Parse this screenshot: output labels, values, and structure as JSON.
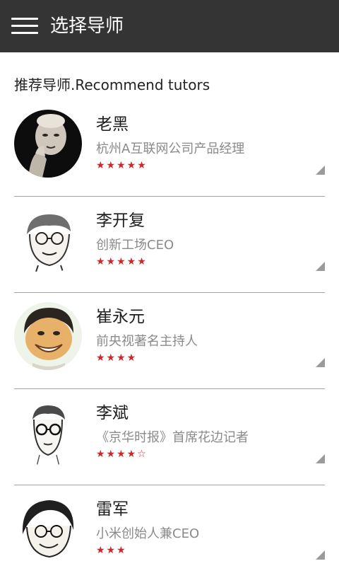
{
  "header": {
    "title": "选择导师",
    "menu_icon": "hamburger-menu-icon"
  },
  "section": {
    "heading": "推荐导师.Recommend tutors"
  },
  "tutors": [
    {
      "name": "老黑",
      "description": "杭州A互联网公司产品经理",
      "stars": "★★★★★",
      "rating": 5
    },
    {
      "name": "李开复",
      "description": "创新工场CEO",
      "stars": "★★★★★",
      "rating": 5
    },
    {
      "name": "崔永元",
      "description": "前央视著名主持人",
      "stars": "★★★★",
      "rating": 4
    },
    {
      "name": "李斌",
      "description": "《京华时报》首席花边记者",
      "stars": "★★★★☆",
      "rating": 4
    },
    {
      "name": "雷军",
      "description": "小米创始人兼CEO",
      "stars": "★★★",
      "rating": 3
    }
  ],
  "colors": {
    "header_bg": "#343434",
    "star": "#d0262b",
    "description": "#8a8a8a",
    "divider": "#a6a6a6"
  }
}
